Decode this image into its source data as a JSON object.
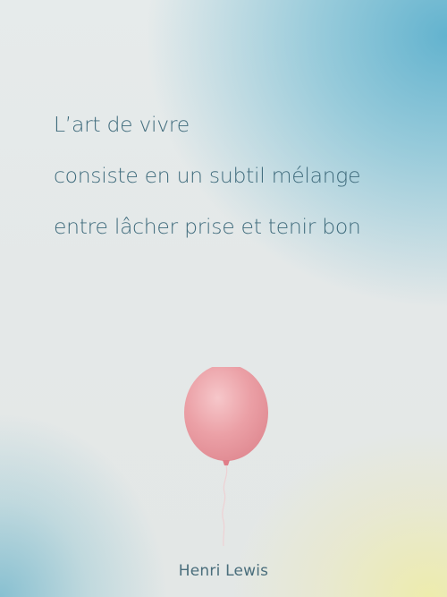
{
  "quote": {
    "lines": [
      "L’art de vivre",
      "consiste en un subtil mélange",
      "entre lâcher prise et tenir bon"
    ]
  },
  "author": "Henri Lewis",
  "balloon": {
    "icon": "balloon-icon",
    "color": "#e89aa0",
    "highlight": "#f4c3c6"
  },
  "colors": {
    "text": "#3f6b7c",
    "sky_blue": "#5cb0cd",
    "warm_yellow": "#eeecaa"
  }
}
